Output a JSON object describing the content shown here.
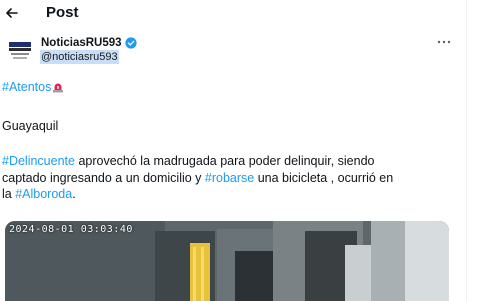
{
  "header": {
    "title": "Post"
  },
  "author": {
    "name": "NoticiasRU593",
    "handle": "@noticiasru593"
  },
  "tweet": {
    "line1_tag": "#Atentos",
    "line2": "Guayaquil",
    "line3": {
      "tag": "#Delincuente",
      "text": " aprovechó la madrugada para poder delinquir, siendo"
    },
    "line4": {
      "text_a": "captado ingresando a un domicilio y ",
      "tag": "#robarse",
      "text_b": " una bicicleta , ocurrió en"
    },
    "line5": {
      "text_a": "la ",
      "tag": "#Alboroda",
      "text_b": "."
    }
  },
  "media": {
    "timestamp": "2024-08-01  03:03:40"
  },
  "colors": {
    "link": "#1d9bf0",
    "text": "#0f1419",
    "handle_highlight": "#c7ddf8"
  },
  "icons": [
    "back-arrow-icon",
    "verified-badge-icon",
    "more-options-icon",
    "siren-emoji-icon"
  ]
}
